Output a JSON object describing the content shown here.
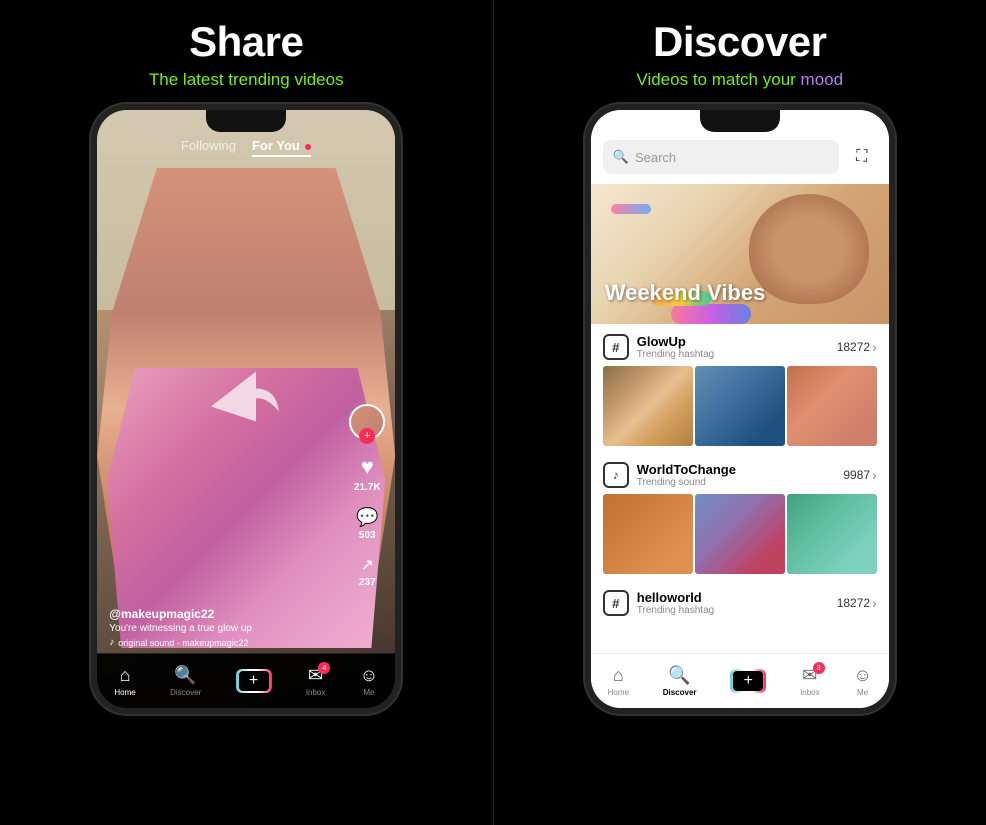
{
  "left_panel": {
    "title": "Share",
    "subtitle_text": "The latest trending ",
    "subtitle_highlight": "videos",
    "tabs": {
      "following": "Following",
      "for_you": "For You"
    },
    "video": {
      "username": "@makeupmagic22",
      "description": "You're witnessing a true glow up",
      "sound": "original sound - makeupmagic22",
      "likes": "21.7K",
      "comments": "503",
      "shares": "237"
    },
    "nav": {
      "home": "Home",
      "discover": "Discover",
      "add": "+",
      "inbox": "Inbox",
      "me": "Me"
    }
  },
  "right_panel": {
    "title": "Discover",
    "subtitle_text": "Videos to match your ",
    "subtitle_highlight": "mood",
    "search_placeholder": "Search",
    "banner_title": "Weekend Vibes",
    "trending_items": [
      {
        "type": "hashtag",
        "name": "GlowUp",
        "category": "Trending hashtag",
        "count": "18272"
      },
      {
        "type": "sound",
        "name": "WorldToChange",
        "category": "Trending sound",
        "count": "9987"
      },
      {
        "type": "hashtag",
        "name": "helloworld",
        "category": "Trending hashtag",
        "count": "18272"
      }
    ],
    "nav": {
      "home": "Home",
      "discover": "Discover",
      "add": "+",
      "inbox": "Inbox",
      "me": "Me"
    }
  }
}
